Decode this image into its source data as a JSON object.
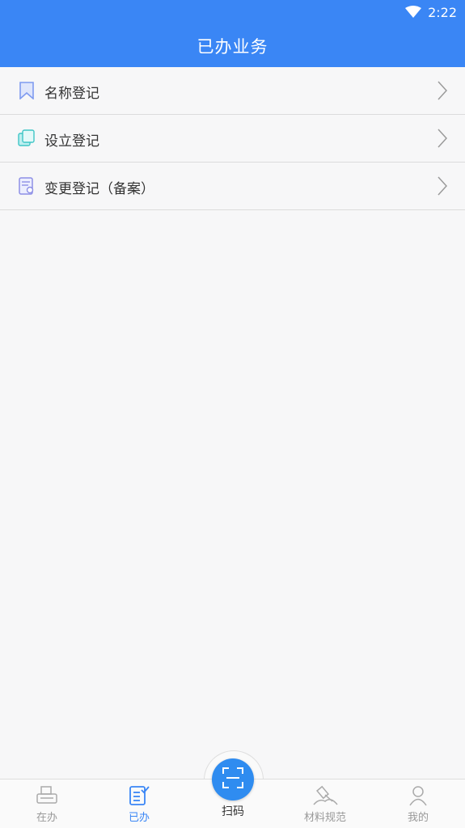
{
  "status_bar": {
    "time": "2:22"
  },
  "header": {
    "title": "已办业务"
  },
  "list": {
    "items": [
      {
        "label": "名称登记",
        "icon": "bookmark-icon"
      },
      {
        "label": "设立登记",
        "icon": "pages-icon"
      },
      {
        "label": "变更登记（备案）",
        "icon": "form-edit-icon"
      }
    ]
  },
  "tabbar": {
    "tabs": [
      {
        "label": "在办",
        "icon": "printer-icon",
        "active": false
      },
      {
        "label": "已办",
        "icon": "checklist-icon",
        "active": true
      },
      {
        "label": "扫码",
        "icon": "scan-icon",
        "active": false
      },
      {
        "label": "材料规范",
        "icon": "gavel-icon",
        "active": false
      },
      {
        "label": "我的",
        "icon": "user-icon",
        "active": false
      }
    ]
  },
  "colors": {
    "primary": "#3a86f5",
    "scan_button": "#2f8cf0",
    "background": "#f7f7f8"
  }
}
